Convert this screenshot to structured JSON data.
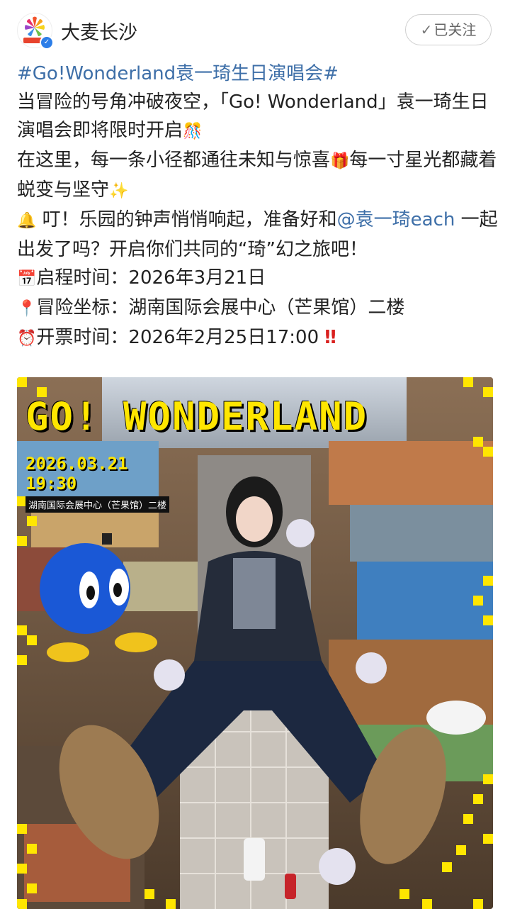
{
  "header": {
    "account_name": "大麦长沙",
    "follow_label": "已关注",
    "avatar_badge": "verified"
  },
  "post": {
    "hashtag": "#Go!Wonderland袁一琦生日演唱会#",
    "line1": "当冒险的号角冲破夜空，「Go! Wonderland」袁一琦生日演唱会即将限时开启",
    "line2a": "在这里，每一条小径都通往未知与惊喜",
    "line2b": "每一寸星光都藏着蜕变与坚守",
    "line3a": " 叮！乐园的钟声悄悄响起，准备好和",
    "mention": "@袁一琦each",
    "line3b": " 一起出发了吗？开启你们共同的“琦”幻之旅吧！",
    "start_label": "启程时间：",
    "start_value": "2026年3月21日",
    "venue_label": "冒险坐标：",
    "venue_value": "湖南国际会展中心（芒果馆）二楼",
    "ticket_label": "开票时间：",
    "ticket_value": "2026年2月25日17:00"
  },
  "poster": {
    "title": "GO! WONDERLAND",
    "date": "2026.03.21",
    "time": "19:30",
    "venue": "湖南国际会展中心（芒果馆）二楼"
  },
  "colors": {
    "link": "#3e6fa8",
    "poster_yellow": "#ffe600"
  }
}
